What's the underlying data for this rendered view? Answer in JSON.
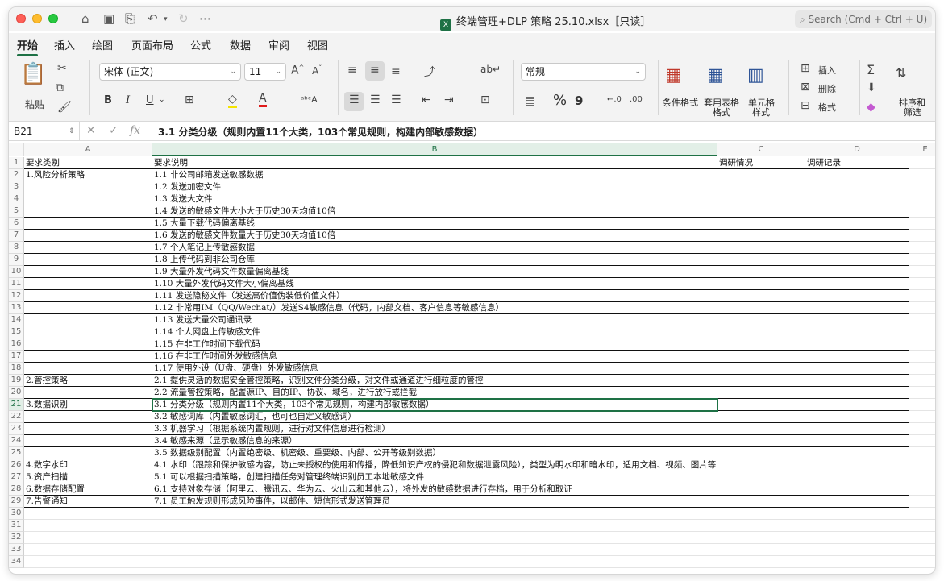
{
  "window": {
    "title": "终端管理+DLP 策略 25.10.xlsx［只读］",
    "file_icon": "excel-file-icon",
    "search_placeholder": "Search (Cmd + Ctrl + U)"
  },
  "ribbon_tabs": [
    "开始",
    "插入",
    "绘图",
    "页面布局",
    "公式",
    "数据",
    "审阅",
    "视图"
  ],
  "active_tab": "开始",
  "ribbon": {
    "paste_label": "粘贴",
    "font_name": "宋体 (正文)",
    "font_size": "11",
    "bold": "B",
    "italic": "I",
    "underline": "U",
    "number_format": "常规",
    "percent": "%",
    "comma": "9",
    "conditional_format": "条件格式",
    "format_as_table_1": "套用表格",
    "format_as_table_2": "格式",
    "cell_styles_1": "单元格",
    "cell_styles_2": "样式",
    "insert_label": "插入",
    "delete_label": "删除",
    "format_label": "格式",
    "sort_filter_1": "排序和",
    "sort_filter_2": "筛选"
  },
  "formula_bar": {
    "name_box": "B21",
    "fx_label": "fx",
    "content": "3.1 分类分级（规则内置11个大类，103个常见规则，构建内部敏感数据）"
  },
  "sheet": {
    "columns": [
      "A",
      "B",
      "C",
      "D",
      "E"
    ],
    "selected_cell": "B21",
    "rows": [
      {
        "n": "1",
        "a": "要求类别",
        "b": "要求说明",
        "c": "调研情况",
        "d": "调研记录"
      },
      {
        "n": "2",
        "a": "1.风险分析策略",
        "b": "1.1 非公司邮箱发送敏感数据",
        "c": "",
        "d": ""
      },
      {
        "n": "3",
        "a": "",
        "b": "1.2 发送加密文件",
        "c": "",
        "d": ""
      },
      {
        "n": "4",
        "a": "",
        "b": "1.3 发送大文件",
        "c": "",
        "d": ""
      },
      {
        "n": "5",
        "a": "",
        "b": "1.4 发送的敏感文件大小大于历史30天均值10倍",
        "c": "",
        "d": ""
      },
      {
        "n": "6",
        "a": "",
        "b": "1.5 大量下载代码偏离基线",
        "c": "",
        "d": ""
      },
      {
        "n": "7",
        "a": "",
        "b": "1.6 发送的敏感文件数量大于历史30天均值10倍",
        "c": "",
        "d": ""
      },
      {
        "n": "8",
        "a": "",
        "b": "1.7 个人笔记上传敏感数据",
        "c": "",
        "d": ""
      },
      {
        "n": "9",
        "a": "",
        "b": "1.8 上传代码到非公司仓库",
        "c": "",
        "d": ""
      },
      {
        "n": "10",
        "a": "",
        "b": "1.9 大量外发代码文件数量偏离基线",
        "c": "",
        "d": ""
      },
      {
        "n": "11",
        "a": "",
        "b": "1.10 大量外发代码文件大小偏离基线",
        "c": "",
        "d": ""
      },
      {
        "n": "12",
        "a": "",
        "b": "1.11 发送隐秘文件（发送高价值伪装低价值文件）",
        "c": "",
        "d": ""
      },
      {
        "n": "13",
        "a": "",
        "b": "1.12 非常用IM（QQ/Wechat/）发送S4敏感信息（代码，内部文档、客户信息等敏感信息）",
        "c": "",
        "d": ""
      },
      {
        "n": "14",
        "a": "",
        "b": "1.13 发送大量公司通讯录",
        "c": "",
        "d": ""
      },
      {
        "n": "15",
        "a": "",
        "b": "1.14 个人网盘上传敏感文件",
        "c": "",
        "d": ""
      },
      {
        "n": "16",
        "a": "",
        "b": "1.15 在非工作时间下载代码",
        "c": "",
        "d": ""
      },
      {
        "n": "17",
        "a": "",
        "b": "1.16 在非工作时间外发敏感信息",
        "c": "",
        "d": ""
      },
      {
        "n": "18",
        "a": "",
        "b": "1.17 使用外设（U盘、硬盘）外发敏感信息",
        "c": "",
        "d": ""
      },
      {
        "n": "19",
        "a": "2.管控策略",
        "b": "2.1 提供灵活的数据安全管控策略，识别文件分类分级，对文件或通道进行细粒度的管控",
        "c": "",
        "d": ""
      },
      {
        "n": "20",
        "a": "",
        "b": "2.2 流量管控策略，配置源IP、目的IP、协议、域名，进行放行或拦截",
        "c": "",
        "d": ""
      },
      {
        "n": "21",
        "a": "3.数据识别",
        "b": "3.1 分类分级（规则内置11个大类，103个常见规则，构建内部敏感数据）",
        "c": "",
        "d": ""
      },
      {
        "n": "22",
        "a": "",
        "b": "3.2 敏感词库（内置敏感词汇，也可也自定义敏感词）",
        "c": "",
        "d": ""
      },
      {
        "n": "23",
        "a": "",
        "b": "3.3 机器学习（根据系统内置规则，进行对文件信息进行检测）",
        "c": "",
        "d": ""
      },
      {
        "n": "24",
        "a": "",
        "b": "3.4 敏感来源（显示敏感信息的来源）",
        "c": "",
        "d": ""
      },
      {
        "n": "25",
        "a": "",
        "b": "3.5 数据级别配置（内置绝密级、机密级、重要级、内部、公开等级别数据）",
        "c": "",
        "d": ""
      },
      {
        "n": "26",
        "a": "4.数字水印",
        "b": "4.1 水印（跟踪和保护敏感内容，防止未授权的使用和传播，降低知识产权的侵犯和数据泄露风险），类型为明水印和暗水印，适用文档、视频、图片等",
        "c": "",
        "d": ""
      },
      {
        "n": "27",
        "a": "5.资产扫描",
        "b": "5.1 可以根据扫描策略，创建扫描任务对管理终端识别员工本地敏感文件",
        "c": "",
        "d": ""
      },
      {
        "n": "28",
        "a": "6.数据存储配置",
        "b": "6.1 支持对象存储（阿里云、腾讯云、华为云、火山云和其他云），将外发的敏感数据进行存档，用于分析和取证",
        "c": "",
        "d": ""
      },
      {
        "n": "29",
        "a": "7.告警通知",
        "b": "7.1 员工触发规则形成风险事件，以邮件、短信形式发送管理员",
        "c": "",
        "d": ""
      },
      {
        "n": "30",
        "a": "",
        "b": "",
        "c": "",
        "d": ""
      },
      {
        "n": "31",
        "a": "",
        "b": "",
        "c": "",
        "d": ""
      },
      {
        "n": "32",
        "a": "",
        "b": "",
        "c": "",
        "d": ""
      },
      {
        "n": "33",
        "a": "",
        "b": "",
        "c": "",
        "d": ""
      },
      {
        "n": "34",
        "a": "",
        "b": "",
        "c": "",
        "d": ""
      }
    ]
  }
}
